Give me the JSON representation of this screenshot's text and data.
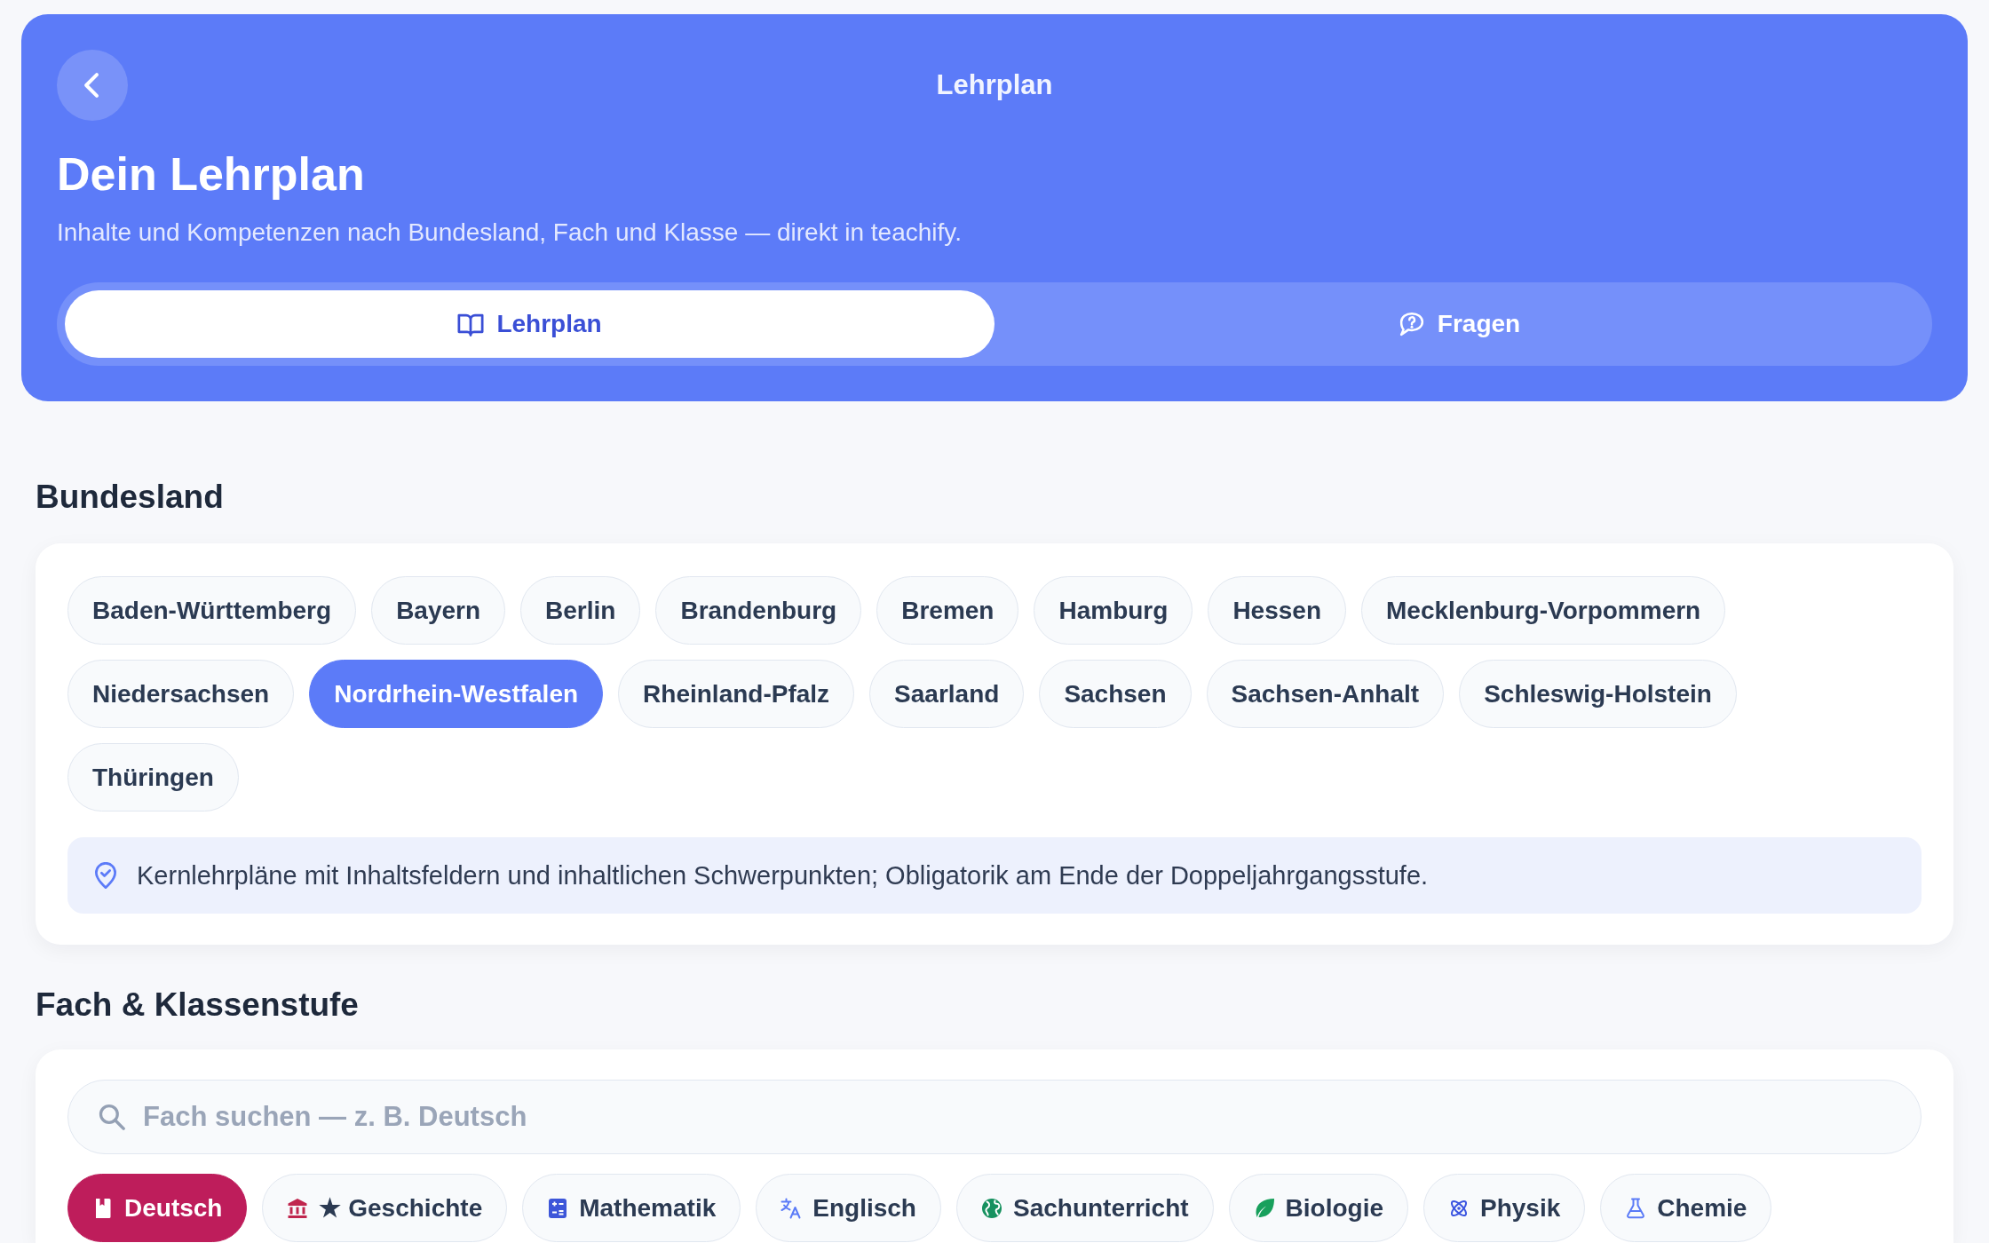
{
  "header": {
    "title": "Lehrplan",
    "heading": "Dein Lehrplan",
    "subtitle": "Inhalte und Kompetenzen nach Bundesland, Fach und Klasse — direkt in teachify.",
    "tabs": [
      {
        "label": "Lehrplan",
        "selected": true
      },
      {
        "label": "Fragen",
        "selected": false
      }
    ]
  },
  "bundesland": {
    "title": "Bundesland",
    "states": [
      {
        "label": "Baden-Württemberg",
        "selected": false
      },
      {
        "label": "Bayern",
        "selected": false
      },
      {
        "label": "Berlin",
        "selected": false
      },
      {
        "label": "Brandenburg",
        "selected": false
      },
      {
        "label": "Bremen",
        "selected": false
      },
      {
        "label": "Hamburg",
        "selected": false
      },
      {
        "label": "Hessen",
        "selected": false
      },
      {
        "label": "Mecklenburg-Vorpommern",
        "selected": false
      },
      {
        "label": "Niedersachsen",
        "selected": false
      },
      {
        "label": "Nordrhein-Westfalen",
        "selected": true
      },
      {
        "label": "Rheinland-Pfalz",
        "selected": false
      },
      {
        "label": "Saarland",
        "selected": false
      },
      {
        "label": "Sachsen",
        "selected": false
      },
      {
        "label": "Sachsen-Anhalt",
        "selected": false
      },
      {
        "label": "Schleswig-Holstein",
        "selected": false
      },
      {
        "label": "Thüringen",
        "selected": false
      }
    ],
    "note": "Kernlehrpläne mit Inhaltsfeldern und inhaltlichen Schwerpunkten; Obligatorik am Ende der Doppeljahrgangsstufe."
  },
  "fach": {
    "title": "Fach & Klassenstufe",
    "search": {
      "placeholder": "Fach suchen — z. B. Deutsch"
    },
    "subjects": [
      {
        "label": "Deutsch",
        "selected": true,
        "color": "#be1d5b"
      },
      {
        "label": "★ Geschichte",
        "selected": false,
        "color": "#c0264e"
      },
      {
        "label": "Mathematik",
        "selected": false,
        "color": "#3d56d9"
      },
      {
        "label": "Englisch",
        "selected": false,
        "color": "#5b7bf7"
      },
      {
        "label": "Sachunterricht",
        "selected": false,
        "color": "#16915f"
      },
      {
        "label": "Biologie",
        "selected": false,
        "color": "#18a05c"
      },
      {
        "label": "Physik",
        "selected": false,
        "color": "#3b55e0"
      },
      {
        "label": "Chemie",
        "selected": false,
        "color": "#5b7bf7"
      }
    ]
  }
}
